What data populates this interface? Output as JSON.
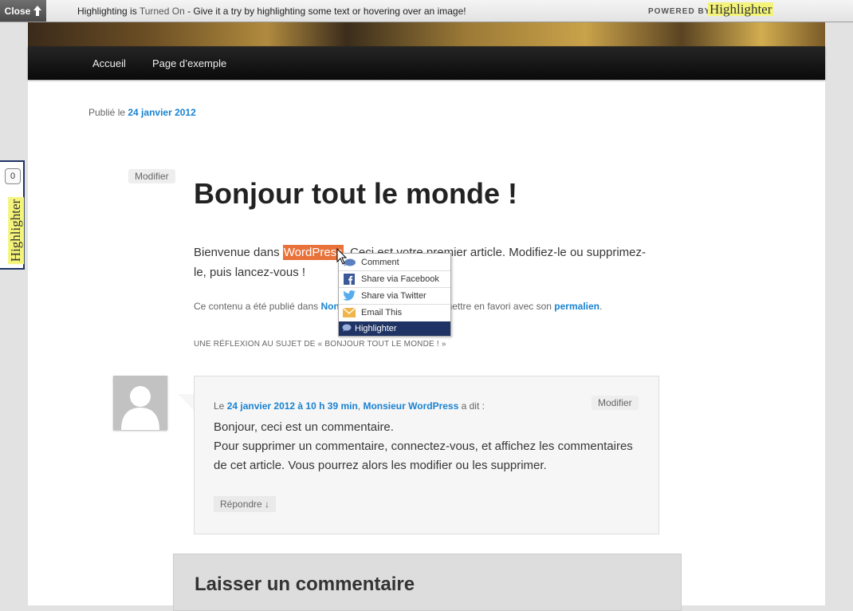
{
  "bar": {
    "close": "Close",
    "msg_pre": "Highlighting is ",
    "msg_on": "Turned On",
    "msg_post": " - Give it a try by highlighting some text or hovering over an image!",
    "powered": "POWERED BY",
    "logo": "Highlighter"
  },
  "nav": {
    "items": [
      "Accueil",
      "Page d’exemple"
    ]
  },
  "post": {
    "published_pre": "Publié le ",
    "published_date": "24 janvier 2012",
    "edit": "Modifier",
    "title": "Bonjour tout le monde !",
    "text_pre": "Bienvenue dans ",
    "text_highlight": "WordPress",
    "text_post": ". Ceci est votre premier article. Modifiez-le ou supprimez-le, puis lancez-vous !",
    "meta_pre": "Ce contenu a été publié dans ",
    "meta_cat": "Non classé",
    "meta_mid": ". Vous pouvez la mettre en favori avec son ",
    "meta_link": "permalien",
    "meta_end": ".",
    "reflect": "UNE RÉFLEXION AU SUJET DE « BONJOUR TOUT LE MONDE ! »"
  },
  "comment": {
    "le": "Le ",
    "date": "24 janvier 2012 à 10 h 39 min",
    "sep": ", ",
    "author": "Monsieur WordPress",
    "said": " a dit :",
    "edit": "Modifier",
    "line1": "Bonjour, ceci est un commentaire.",
    "line2": "Pour supprimer un commentaire, connectez-vous, et affichez les commentaires de cet article. Vous pourrez alors les modifier ou les supprimer.",
    "reply": "Répondre ↓"
  },
  "leave": {
    "title": "Laisser un commentaire"
  },
  "side": {
    "count": "0",
    "logo": "Highlighter"
  },
  "popup": {
    "comment": "Comment",
    "facebook": "Share via Facebook",
    "twitter": "Share via Twitter",
    "email": "Email This",
    "footer": "Highlighter"
  }
}
